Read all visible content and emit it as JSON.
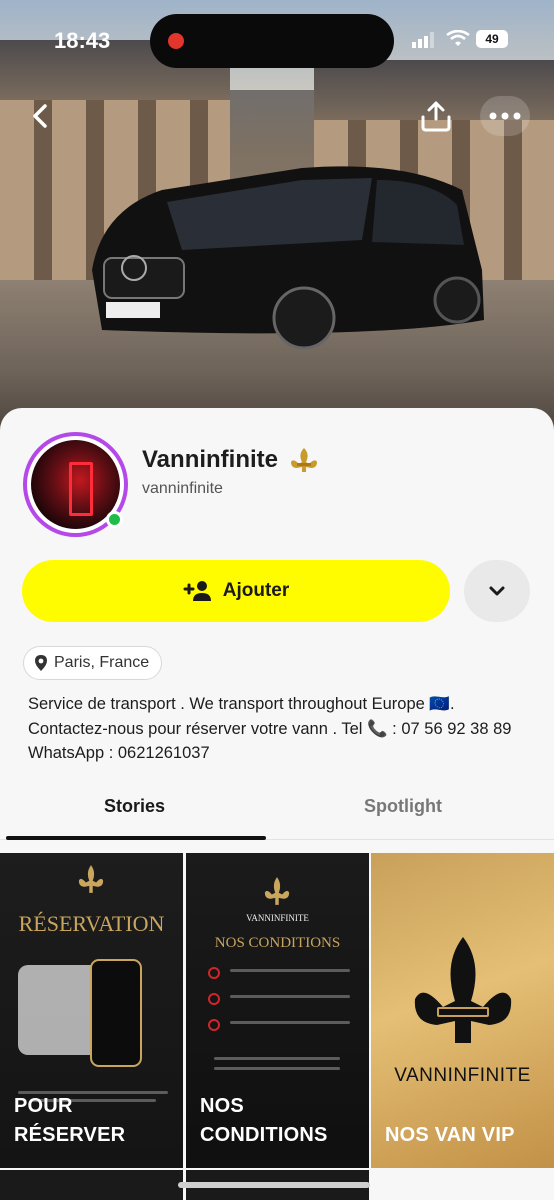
{
  "status_bar": {
    "time": "18:43",
    "battery": "49"
  },
  "profile": {
    "name": "Vanninfinite",
    "handle": "vanninfinite",
    "add_label": "Ajouter",
    "location": "Paris, France",
    "bio_lines": [
      "Service de transport .  We transport throughout Europe 🇪🇺.",
      "Contactez-nous pour réserver votre vann . Tel 📞 : 07 56 92 38 89",
      "WhatsApp : 0621261037"
    ]
  },
  "tabs": [
    {
      "label": "Stories",
      "active": true
    },
    {
      "label": "Spotlight",
      "active": false
    }
  ],
  "tiles": [
    {
      "title": "RÉSERVATION",
      "caption_line1": "POUR",
      "caption_line2": "RÉSERVER"
    },
    {
      "brand": "VANNINFINITE",
      "title": "NOS CONDITIONS",
      "caption_line1": "NOS",
      "caption_line2": "CONDITIONS"
    },
    {
      "brand": "VANNINFINITE",
      "caption_line1": "NOS VAN VIP"
    }
  ],
  "colors": {
    "accent_yellow": "#fffc00",
    "ring_purple": "#b548e9",
    "online_green": "#1fbc4b",
    "gold": "#c9a55e"
  }
}
